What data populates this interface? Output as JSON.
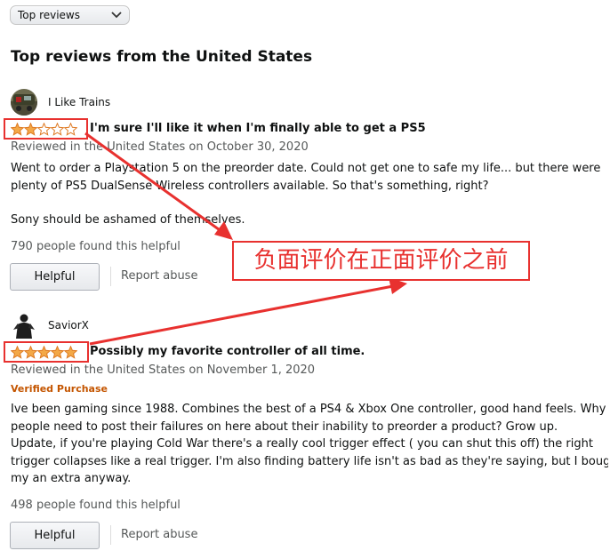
{
  "sort_select": {
    "value": "Top reviews",
    "chevron_icon": "chevron-down-icon"
  },
  "section_title": "Top reviews from the United States",
  "reviews": [
    {
      "author": "I Like Trains",
      "rating": 2,
      "rating_out_of": 5,
      "title": "I'm sure I'll like it when I'm finally able to get a PS5",
      "date": "Reviewed in the United States on October 30, 2020",
      "verified": "",
      "body": [
        "Went to order a Playstation 5 on the preorder date. Could not get one to safe my life... but there were",
        "plenty of PS5 DualSense Wireless controllers available. So that's something, right?",
        "Sony should be ashamed of themselves."
      ],
      "helpful_text": "790 people found this helpful",
      "helpful_button": "Helpful",
      "report_link": "Report abuse"
    },
    {
      "author": "SaviorX",
      "rating": 5,
      "rating_out_of": 5,
      "title": "Possibly my favorite controller of all time.",
      "date": "Reviewed in the United States on November 1, 2020",
      "verified": "Verified Purchase",
      "body": [
        "Ive been gaming since 1988. Combines the best of a PS4 & Xbox One controller, good hand feels. Why do",
        "people need to post their failures on here about their inability to preorder a product? Grow up.",
        "Update, if you're playing Cold War there's a really cool trigger effect ( you can shut this off) the right",
        "trigger collapses like a real trigger. I'm also finding battery life isn't as bad as they're saying, but I bough",
        "my an extra anyway."
      ],
      "helpful_text": "498 people found this helpful",
      "helpful_button": "Helpful",
      "report_link": "Report abuse"
    }
  ],
  "annotation": {
    "text": "负面评价在正面评价之前",
    "color": "#e8312f"
  },
  "colors": {
    "star_filled": "#f3a847",
    "star_outline": "#de7921",
    "verified": "#c45500",
    "secondary_text": "#565959"
  }
}
